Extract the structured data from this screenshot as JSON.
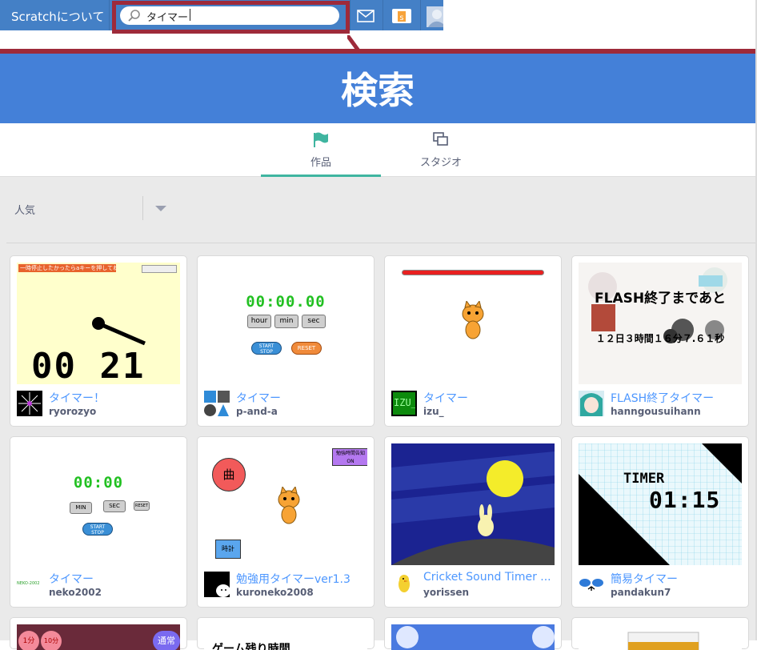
{
  "topbar": {
    "about_label": "Scratchについて",
    "search_value": "タイマー",
    "colors": {
      "bar": "#4480c6",
      "highlight": "#9e2a3a"
    }
  },
  "banner": {
    "title": "検索"
  },
  "tabs": [
    {
      "label": "作品",
      "active": true,
      "icon": "flag-icon"
    },
    {
      "label": "スタジオ",
      "active": false,
      "icon": "studio-icon"
    }
  ],
  "filter": {
    "label": "人気"
  },
  "projects": [
    {
      "title": "タイマー！",
      "author": "ryorozyo"
    },
    {
      "title": "タイマー",
      "author": "p-and-a"
    },
    {
      "title": "タイマー",
      "author": "izu_"
    },
    {
      "title": "FLASH終了タイマー",
      "author": "hanngousuihann"
    },
    {
      "title": "タイマー",
      "author": "neko2002"
    },
    {
      "title": "勉強用タイマーver1.3",
      "author": "kuroneko2008"
    },
    {
      "title": "Cricket Sound Timer ...",
      "author": "yorissen"
    },
    {
      "title": "簡易タイマー",
      "author": "pandakun7"
    }
  ],
  "thumbs": {
    "t1_banner": "一時停止したかったらaキーを押してね！",
    "t1_digits": "00 21",
    "t2_time": "00:00.00",
    "t2_btn_hour": "hour",
    "t2_btn_min": "min",
    "t2_btn_sec": "sec",
    "t2_start": "START STOP",
    "t2_reset": "RESET",
    "t4_line1": "FLASH終了まであと",
    "t4_line2": "１２日３時間１６分７.６１秒",
    "t5_time": "00:00",
    "t5_min": "MIN",
    "t5_sec": "SEC",
    "t5_reset": "RESET",
    "t5_start": "START STOP",
    "t6_circle": "曲",
    "t6_box": "時計",
    "t6_notice": "勉強時間告知 ON",
    "t8_label": "TIMER",
    "t8_time": "01:15",
    "t9_text": "1分",
    "t9_text2": "10分",
    "t9_badge": "通常",
    "t10_text": "ゲーム残り時間",
    "i3_text": "IZU_",
    "i5_text": "NEKO-2002"
  }
}
